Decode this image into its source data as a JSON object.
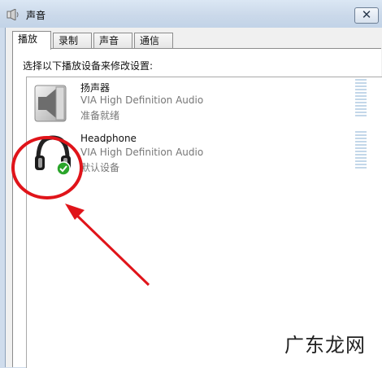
{
  "window": {
    "title": "声音",
    "close_label": "✕"
  },
  "tabs": [
    {
      "label": "播放",
      "active": true
    },
    {
      "label": "录制",
      "active": false
    },
    {
      "label": "声音",
      "active": false
    },
    {
      "label": "通信",
      "active": false
    }
  ],
  "panel": {
    "instruction": "选择以下播放设备来修改设置:"
  },
  "devices": [
    {
      "icon": "speaker-icon",
      "name": "扬声器",
      "driver": "VIA High Definition Audio",
      "status": "准备就绪",
      "default": false
    },
    {
      "icon": "headphone-icon",
      "name": "Headphone",
      "driver": "VIA High Definition Audio",
      "status": "默认设备",
      "default": true
    }
  ],
  "annotation": {
    "circle_color": "#e0141a",
    "arrow_color": "#e0141a"
  },
  "watermark": "广东龙网",
  "colors": {
    "default_check": "#2aa52a",
    "level_meter": "#c3d7e9"
  }
}
